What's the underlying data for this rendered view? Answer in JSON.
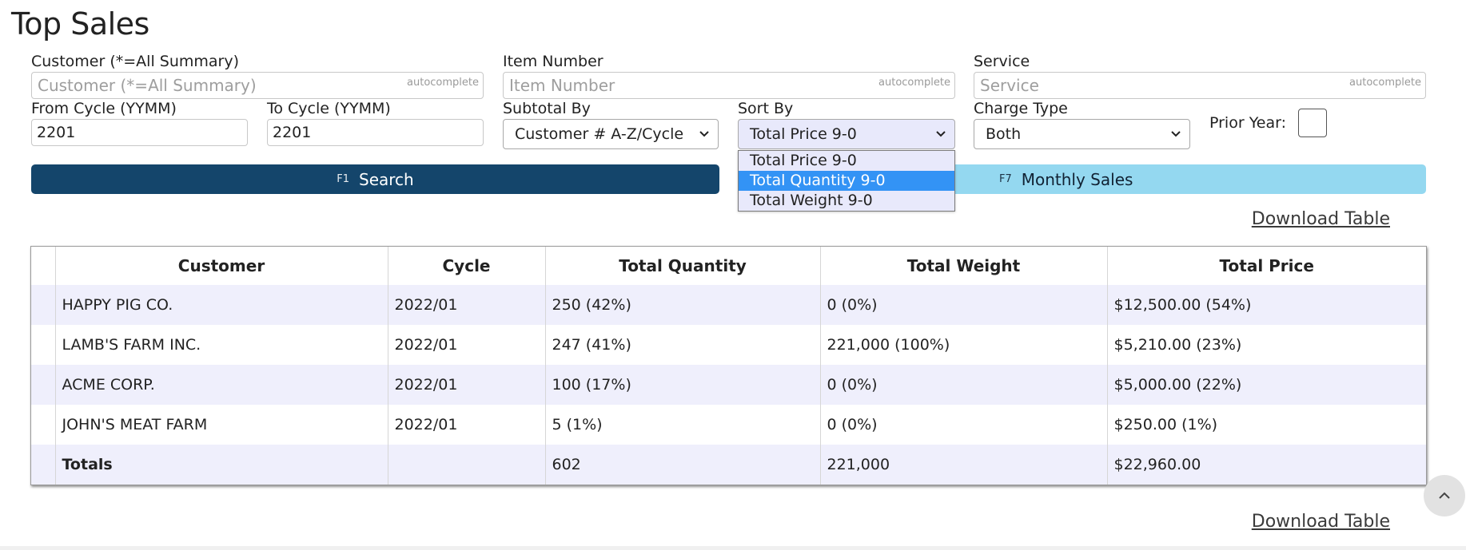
{
  "page": {
    "title": "Top Sales"
  },
  "filters": {
    "customer": {
      "label": "Customer (*=All Summary)",
      "placeholder": "Customer (*=All Summary)",
      "tag": "autocomplete"
    },
    "item_number": {
      "label": "Item Number",
      "placeholder": "Item Number",
      "tag": "autocomplete"
    },
    "service": {
      "label": "Service",
      "placeholder": "Service",
      "tag": "autocomplete"
    },
    "from_cycle": {
      "label": "From Cycle (YYMM)",
      "value": "2201"
    },
    "to_cycle": {
      "label": "To Cycle (YYMM)",
      "value": "2201"
    },
    "subtotal_by": {
      "label": "Subtotal By",
      "value": "Customer # A-Z/Cycle"
    },
    "sort_by": {
      "label": "Sort By",
      "value": "Total Price 9-0",
      "options": [
        "Total Price 9-0",
        "Total Quantity 9-0",
        "Total Weight 9-0"
      ],
      "highlighted": "Total Quantity 9-0"
    },
    "charge_type": {
      "label": "Charge Type",
      "value": "Both"
    },
    "prior_year": {
      "label": "Prior Year:",
      "checked": false
    }
  },
  "actions": {
    "search": {
      "key": "F1",
      "label": "Search"
    },
    "monthly": {
      "key": "F7",
      "label": "Monthly Sales"
    },
    "download": "Download Table"
  },
  "table": {
    "headers": [
      "Customer",
      "Cycle",
      "Total Quantity",
      "Total Weight",
      "Total Price"
    ],
    "rows": [
      [
        "HAPPY PIG CO.",
        "2022/01",
        "250 (42%)",
        "0 (0%)",
        "$12,500.00 (54%)"
      ],
      [
        "LAMB'S FARM INC.",
        "2022/01",
        "247 (41%)",
        "221,000 (100%)",
        "$5,210.00 (23%)"
      ],
      [
        "ACME CORP.",
        "2022/01",
        "100 (17%)",
        "0 (0%)",
        "$5,000.00 (22%)"
      ],
      [
        "JOHN'S MEAT FARM",
        "2022/01",
        "5 (1%)",
        "0 (0%)",
        "$250.00 (1%)"
      ]
    ],
    "totals": [
      "Totals",
      "",
      "602",
      "221,000",
      "$22,960.00"
    ]
  },
  "colors": {
    "search_button": "#14456b",
    "monthly_button": "#94d8f0",
    "row_stripe": "#efeffc",
    "dropdown_highlight": "#3393f5"
  },
  "icons": {
    "scroll_top": "chevron-up-icon",
    "select_arrow": "chevron-down-icon"
  }
}
